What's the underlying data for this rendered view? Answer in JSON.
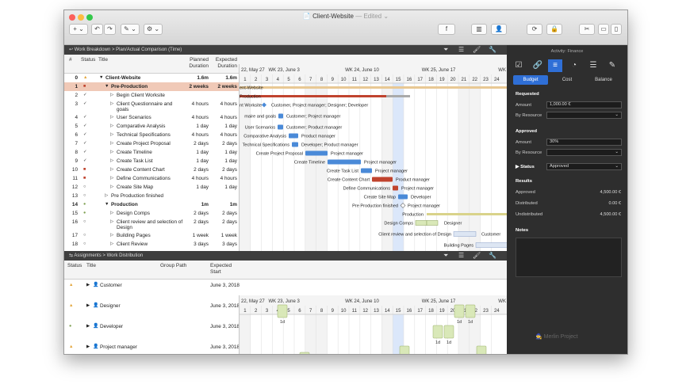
{
  "window": {
    "title": "Client-Website",
    "edited": "— Edited ⌄"
  },
  "toolbar": {
    "add": "+ ⌄",
    "undo": "↶",
    "redo": "↷",
    "pen": "✎ ⌄",
    "gear": "⚙ ⌄",
    "formula": "f",
    "library": "▥",
    "person": "👤",
    "sync": "⟳",
    "lock": "🔒",
    "tools": "✂",
    "layout1": "▭",
    "layout2": "▯"
  },
  "breadcrumb_top": {
    "root": "Work Breakdown",
    "sep": ">",
    "leaf": "Plan/Actual Comparison (Time)"
  },
  "breadcrumb_bottom": {
    "root": "Assignments",
    "sep": ">",
    "leaf": "Work Distribution"
  },
  "wbs_columns": {
    "num": "#",
    "status": "Status",
    "title": "Title",
    "planned": "Planned Duration",
    "expected": "Expected Duration"
  },
  "tasks": [
    {
      "num": "0",
      "status": "▲",
      "title": "Client-Website",
      "planned": "1.6m",
      "expected": "1.6m",
      "bold": true,
      "level": 0,
      "toggle": "▼"
    },
    {
      "num": "1",
      "status": "■",
      "title": "Pre-Production",
      "planned": "2 weeks",
      "expected": "2 weeks",
      "bold": true,
      "level": 1,
      "toggle": "▼",
      "selected": true
    },
    {
      "num": "2",
      "status": "✓",
      "title": "Begin Client Worksite",
      "planned": "",
      "expected": "",
      "level": 2,
      "toggle": "▷"
    },
    {
      "num": "3",
      "status": "✓",
      "title": "Client Questionnaire and goals",
      "planned": "4 hours",
      "expected": "4 hours",
      "level": 2,
      "toggle": "▷",
      "tall": true
    },
    {
      "num": "4",
      "status": "✓",
      "title": "User Scenarios",
      "planned": "4 hours",
      "expected": "4 hours",
      "level": 2,
      "toggle": "▷"
    },
    {
      "num": "5",
      "status": "✓",
      "title": "Comparative Analysis",
      "planned": "1 day",
      "expected": "1 day",
      "level": 2,
      "toggle": "▷"
    },
    {
      "num": "6",
      "status": "✓",
      "title": "Technical Specifications",
      "planned": "4 hours",
      "expected": "4 hours",
      "level": 2,
      "toggle": "▷"
    },
    {
      "num": "7",
      "status": "✓",
      "title": "Create Project Proposal",
      "planned": "2 days",
      "expected": "2 days",
      "level": 2,
      "toggle": "▷"
    },
    {
      "num": "8",
      "status": "✓",
      "title": "Create Timeline",
      "planned": "1 day",
      "expected": "1 day",
      "level": 2,
      "toggle": "▷"
    },
    {
      "num": "9",
      "status": "✓",
      "title": "Create Task List",
      "planned": "1 day",
      "expected": "1 day",
      "level": 2,
      "toggle": "▷"
    },
    {
      "num": "10",
      "status": "■",
      "title": "Create Content Chart",
      "planned": "2 days",
      "expected": "2 days",
      "level": 2,
      "toggle": "▷"
    },
    {
      "num": "11",
      "status": "■",
      "title": "Define Communications",
      "planned": "4 hours",
      "expected": "4 hours",
      "level": 2,
      "toggle": "▷"
    },
    {
      "num": "12",
      "status": "○",
      "title": "Create Site Map",
      "planned": "1 day",
      "expected": "1 day",
      "level": 2,
      "toggle": "▷"
    },
    {
      "num": "13",
      "status": "○",
      "title": "Pre Production finished",
      "planned": "",
      "expected": "",
      "level": 1,
      "toggle": "▷"
    },
    {
      "num": "14",
      "status": "●",
      "title": "Production",
      "planned": "1m",
      "expected": "1m",
      "bold": true,
      "level": 1,
      "toggle": "▼"
    },
    {
      "num": "15",
      "status": "●",
      "title": "Design Comps",
      "planned": "2 days",
      "expected": "2 days",
      "level": 2,
      "toggle": "▷"
    },
    {
      "num": "16",
      "status": "○",
      "title": "Client review and selection of Design",
      "planned": "2 days",
      "expected": "2 days",
      "level": 2,
      "toggle": "▷",
      "tall": true
    },
    {
      "num": "17",
      "status": "○",
      "title": "Building Pages",
      "planned": "1 week",
      "expected": "1 week",
      "level": 2,
      "toggle": "▷"
    },
    {
      "num": "18",
      "status": "○",
      "title": "Client Review",
      "planned": "3 days",
      "expected": "3 days",
      "level": 2,
      "toggle": "▷"
    }
  ],
  "timeline": {
    "weeks": [
      "22, May 27",
      "WK 23, June 3",
      "WK 24, June 10",
      "WK 25, June 17",
      "WK 2"
    ],
    "days": [
      "1",
      "2",
      "3",
      "4",
      "5",
      "6",
      "7",
      "8",
      "9",
      "10",
      "11",
      "12",
      "13",
      "14",
      "15",
      "16",
      "17",
      "18",
      "19",
      "20",
      "21",
      "22",
      "23",
      "24"
    ]
  },
  "gantt_labels": [
    "ent-Website",
    "Production",
    "nt Worksite",
    "Customer, Project manager; Designer; Developer",
    "maire and goals",
    "Customer; Project manager",
    "User Scenarios",
    "Customer; Product manager",
    "Comparative Analysis",
    "Product manager",
    "Technical Specifications",
    "Developer; Product manager",
    "Create Project Proposal",
    "Project manager",
    "Create Timeline",
    "Project manager",
    "Create Task List",
    "Project manager",
    "Create Content Chart",
    "Product manager",
    "Define Communications",
    "Project manager",
    "Create Site Map",
    "Developer",
    "Pre Production finished",
    "Project manager",
    "Production",
    "Design Comps",
    "Designer",
    "Client review and selection of Design",
    "Customer",
    "Building Pages"
  ],
  "assign_columns": {
    "status": "Status",
    "title": "Title",
    "group": "Group Path",
    "start": "Expected Start"
  },
  "assignments": [
    {
      "status": "▲",
      "title": "Customer",
      "start": "June 3, 2018"
    },
    {
      "status": "▲",
      "title": "Designer",
      "start": "June 3, 2018"
    },
    {
      "status": "●",
      "title": "Developer",
      "start": "June 3, 2018"
    },
    {
      "status": "▲",
      "title": "Project manager",
      "start": "June 3, 2018"
    }
  ],
  "work_labels": {
    "d1": "1d",
    "h4": "4h"
  },
  "inspector": {
    "activity": "Activity: Finance",
    "tabs": [
      "Budget",
      "Cost",
      "Balance"
    ],
    "requested": "Requested",
    "amount_label": "Amount",
    "amount_value": "1,000.00 €",
    "by_resource_label": "By Resource",
    "approved": "Approved",
    "approved_amount_value": "30%",
    "status_label": "Status",
    "status_value": "Approved",
    "results": "Results",
    "res_approved_label": "Approved",
    "res_approved_value": "4,500.00 €",
    "res_distributed_label": "Distributed",
    "res_distributed_value": "0.00 €",
    "res_undistributed_label": "Undistributed",
    "res_undistributed_value": "4,500.00 €",
    "notes": "Notes",
    "watermark": "Merlin Project"
  },
  "colors": {
    "accent": "#2f6fd6",
    "selected_row": "#f0c9b7",
    "bar_blue": "#4a8ad8",
    "bar_red": "#c0432e",
    "bar_green": "#d9e8b8",
    "dark": "#2e2e2e"
  }
}
